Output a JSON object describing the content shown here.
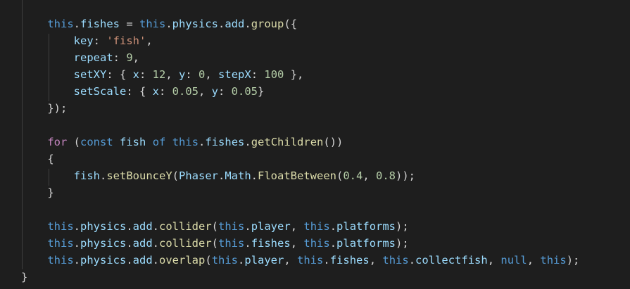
{
  "editor": {
    "theme_colors": {
      "background": "#1e1e1e",
      "keyword": "#569cd6",
      "control": "#c586c0",
      "variable": "#9cdcfe",
      "function": "#dcdcaa",
      "class": "#4ec9b0",
      "string": "#ce9178",
      "number": "#b5cea8",
      "plain": "#d4d4d4"
    },
    "lines": [
      {
        "tokens": [
          {
            "t": "    ",
            "c": "plain"
          },
          {
            "t": "this",
            "c": "kw"
          },
          {
            "t": ".",
            "c": "plain"
          },
          {
            "t": "fishes",
            "c": "var"
          },
          {
            "t": " = ",
            "c": "plain"
          },
          {
            "t": "this",
            "c": "kw"
          },
          {
            "t": ".",
            "c": "plain"
          },
          {
            "t": "physics",
            "c": "var"
          },
          {
            "t": ".",
            "c": "plain"
          },
          {
            "t": "add",
            "c": "var"
          },
          {
            "t": ".",
            "c": "plain"
          },
          {
            "t": "group",
            "c": "fn"
          },
          {
            "t": "({",
            "c": "plain"
          }
        ]
      },
      {
        "tokens": [
          {
            "t": "        ",
            "c": "plain"
          },
          {
            "t": "key",
            "c": "var"
          },
          {
            "t": ": ",
            "c": "plain"
          },
          {
            "t": "'fish'",
            "c": "str"
          },
          {
            "t": ",",
            "c": "plain"
          }
        ]
      },
      {
        "tokens": [
          {
            "t": "        ",
            "c": "plain"
          },
          {
            "t": "repeat",
            "c": "var"
          },
          {
            "t": ": ",
            "c": "plain"
          },
          {
            "t": "9",
            "c": "num"
          },
          {
            "t": ",",
            "c": "plain"
          }
        ]
      },
      {
        "tokens": [
          {
            "t": "        ",
            "c": "plain"
          },
          {
            "t": "setXY",
            "c": "var"
          },
          {
            "t": ": { ",
            "c": "plain"
          },
          {
            "t": "x",
            "c": "var"
          },
          {
            "t": ": ",
            "c": "plain"
          },
          {
            "t": "12",
            "c": "num"
          },
          {
            "t": ", ",
            "c": "plain"
          },
          {
            "t": "y",
            "c": "var"
          },
          {
            "t": ": ",
            "c": "plain"
          },
          {
            "t": "0",
            "c": "num"
          },
          {
            "t": ", ",
            "c": "plain"
          },
          {
            "t": "stepX",
            "c": "var"
          },
          {
            "t": ": ",
            "c": "plain"
          },
          {
            "t": "100",
            "c": "num"
          },
          {
            "t": " },",
            "c": "plain"
          }
        ]
      },
      {
        "tokens": [
          {
            "t": "        ",
            "c": "plain"
          },
          {
            "t": "setScale",
            "c": "var"
          },
          {
            "t": ": { ",
            "c": "plain"
          },
          {
            "t": "x",
            "c": "var"
          },
          {
            "t": ": ",
            "c": "plain"
          },
          {
            "t": "0.05",
            "c": "num"
          },
          {
            "t": ", ",
            "c": "plain"
          },
          {
            "t": "y",
            "c": "var"
          },
          {
            "t": ": ",
            "c": "plain"
          },
          {
            "t": "0.05",
            "c": "num"
          },
          {
            "t": "}",
            "c": "plain"
          }
        ]
      },
      {
        "tokens": [
          {
            "t": "    ",
            "c": "plain"
          },
          {
            "t": "});",
            "c": "plain"
          }
        ]
      },
      {
        "tokens": []
      },
      {
        "tokens": [
          {
            "t": "    ",
            "c": "plain"
          },
          {
            "t": "for",
            "c": "ctrl"
          },
          {
            "t": " (",
            "c": "plain"
          },
          {
            "t": "const",
            "c": "kw"
          },
          {
            "t": " ",
            "c": "plain"
          },
          {
            "t": "fish",
            "c": "var"
          },
          {
            "t": " ",
            "c": "plain"
          },
          {
            "t": "of",
            "c": "kw"
          },
          {
            "t": " ",
            "c": "plain"
          },
          {
            "t": "this",
            "c": "kw"
          },
          {
            "t": ".",
            "c": "plain"
          },
          {
            "t": "fishes",
            "c": "var"
          },
          {
            "t": ".",
            "c": "plain"
          },
          {
            "t": "getChildren",
            "c": "fn"
          },
          {
            "t": "())",
            "c": "plain"
          }
        ]
      },
      {
        "tokens": [
          {
            "t": "    ",
            "c": "plain"
          },
          {
            "t": "{",
            "c": "plain"
          }
        ]
      },
      {
        "tokens": [
          {
            "t": "        ",
            "c": "plain"
          },
          {
            "t": "fish",
            "c": "var"
          },
          {
            "t": ".",
            "c": "plain"
          },
          {
            "t": "setBounceY",
            "c": "fn"
          },
          {
            "t": "(",
            "c": "plain"
          },
          {
            "t": "Phaser",
            "c": "var"
          },
          {
            "t": ".",
            "c": "plain"
          },
          {
            "t": "Math",
            "c": "var"
          },
          {
            "t": ".",
            "c": "plain"
          },
          {
            "t": "FloatBetween",
            "c": "fn"
          },
          {
            "t": "(",
            "c": "plain"
          },
          {
            "t": "0.4",
            "c": "num"
          },
          {
            "t": ", ",
            "c": "plain"
          },
          {
            "t": "0.8",
            "c": "num"
          },
          {
            "t": "));",
            "c": "plain"
          }
        ]
      },
      {
        "tokens": [
          {
            "t": "    ",
            "c": "plain"
          },
          {
            "t": "}",
            "c": "plain"
          }
        ]
      },
      {
        "tokens": []
      },
      {
        "tokens": [
          {
            "t": "    ",
            "c": "plain"
          },
          {
            "t": "this",
            "c": "kw"
          },
          {
            "t": ".",
            "c": "plain"
          },
          {
            "t": "physics",
            "c": "var"
          },
          {
            "t": ".",
            "c": "plain"
          },
          {
            "t": "add",
            "c": "var"
          },
          {
            "t": ".",
            "c": "plain"
          },
          {
            "t": "collider",
            "c": "fn"
          },
          {
            "t": "(",
            "c": "plain"
          },
          {
            "t": "this",
            "c": "kw"
          },
          {
            "t": ".",
            "c": "plain"
          },
          {
            "t": "player",
            "c": "var"
          },
          {
            "t": ", ",
            "c": "plain"
          },
          {
            "t": "this",
            "c": "kw"
          },
          {
            "t": ".",
            "c": "plain"
          },
          {
            "t": "platforms",
            "c": "var"
          },
          {
            "t": ");",
            "c": "plain"
          }
        ]
      },
      {
        "tokens": [
          {
            "t": "    ",
            "c": "plain"
          },
          {
            "t": "this",
            "c": "kw"
          },
          {
            "t": ".",
            "c": "plain"
          },
          {
            "t": "physics",
            "c": "var"
          },
          {
            "t": ".",
            "c": "plain"
          },
          {
            "t": "add",
            "c": "var"
          },
          {
            "t": ".",
            "c": "plain"
          },
          {
            "t": "collider",
            "c": "fn"
          },
          {
            "t": "(",
            "c": "plain"
          },
          {
            "t": "this",
            "c": "kw"
          },
          {
            "t": ".",
            "c": "plain"
          },
          {
            "t": "fishes",
            "c": "var"
          },
          {
            "t": ", ",
            "c": "plain"
          },
          {
            "t": "this",
            "c": "kw"
          },
          {
            "t": ".",
            "c": "plain"
          },
          {
            "t": "platforms",
            "c": "var"
          },
          {
            "t": ");",
            "c": "plain"
          }
        ]
      },
      {
        "tokens": [
          {
            "t": "    ",
            "c": "plain"
          },
          {
            "t": "this",
            "c": "kw"
          },
          {
            "t": ".",
            "c": "plain"
          },
          {
            "t": "physics",
            "c": "var"
          },
          {
            "t": ".",
            "c": "plain"
          },
          {
            "t": "add",
            "c": "var"
          },
          {
            "t": ".",
            "c": "plain"
          },
          {
            "t": "overlap",
            "c": "fn"
          },
          {
            "t": "(",
            "c": "plain"
          },
          {
            "t": "this",
            "c": "kw"
          },
          {
            "t": ".",
            "c": "plain"
          },
          {
            "t": "player",
            "c": "var"
          },
          {
            "t": ", ",
            "c": "plain"
          },
          {
            "t": "this",
            "c": "kw"
          },
          {
            "t": ".",
            "c": "plain"
          },
          {
            "t": "fishes",
            "c": "var"
          },
          {
            "t": ", ",
            "c": "plain"
          },
          {
            "t": "this",
            "c": "kw"
          },
          {
            "t": ".",
            "c": "plain"
          },
          {
            "t": "collectfish",
            "c": "var"
          },
          {
            "t": ", ",
            "c": "plain"
          },
          {
            "t": "null",
            "c": "kw"
          },
          {
            "t": ", ",
            "c": "plain"
          },
          {
            "t": "this",
            "c": "kw"
          },
          {
            "t": ");",
            "c": "plain"
          }
        ]
      },
      {
        "tokens": [
          {
            "t": "}",
            "c": "plain"
          }
        ]
      }
    ]
  }
}
